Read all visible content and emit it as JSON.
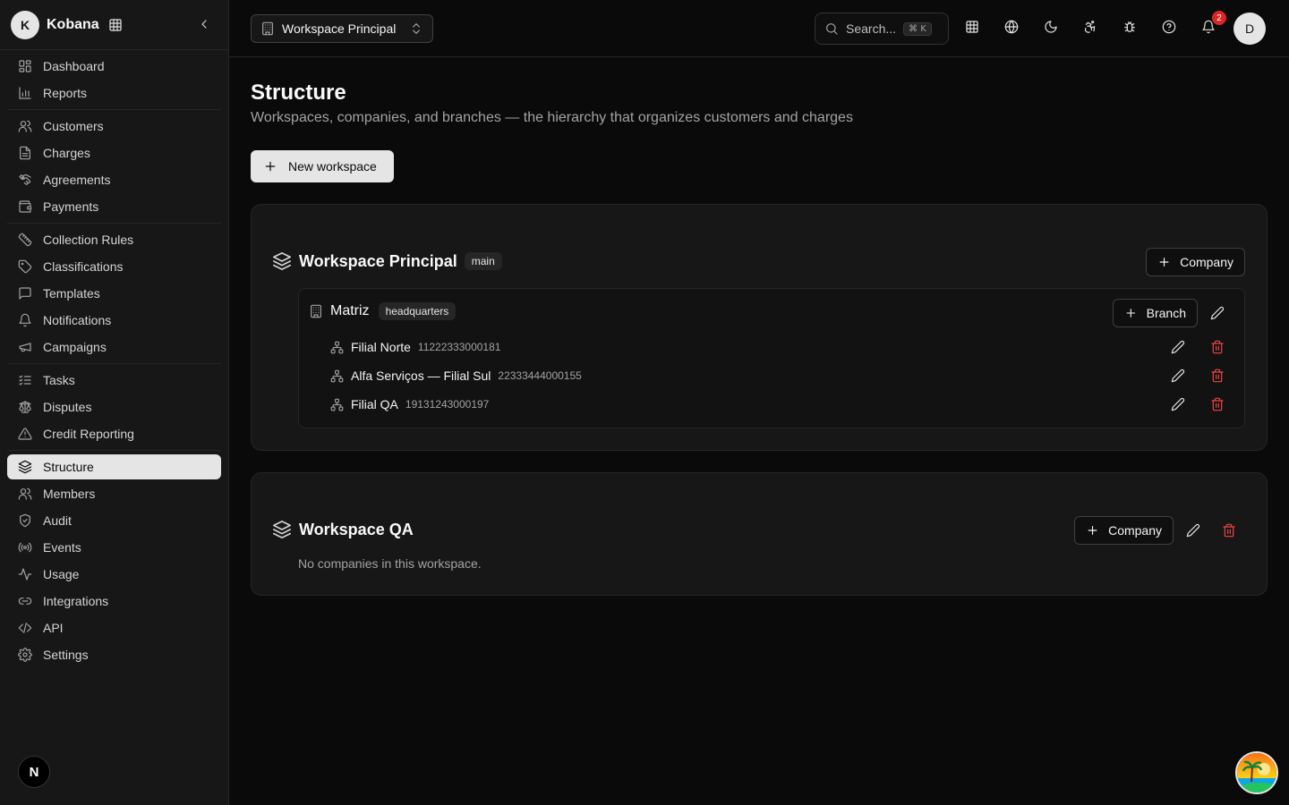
{
  "brand": {
    "initial": "K",
    "name": "Kobana"
  },
  "nav": {
    "dashboard": "Dashboard",
    "reports": "Reports",
    "customers": "Customers",
    "charges": "Charges",
    "agreements": "Agreements",
    "payments": "Payments",
    "collection_rules": "Collection Rules",
    "classifications": "Classifications",
    "templates": "Templates",
    "notifications": "Notifications",
    "campaigns": "Campaigns",
    "tasks": "Tasks",
    "disputes": "Disputes",
    "credit_reporting": "Credit Reporting",
    "structure": "Structure",
    "members": "Members",
    "audit": "Audit",
    "events": "Events",
    "usage": "Usage",
    "integrations": "Integrations",
    "api": "API",
    "settings": "Settings"
  },
  "topbar": {
    "workspace": "Workspace Principal",
    "search_placeholder": "Search...",
    "search_shortcut": "⌘ K",
    "notification_count": "2",
    "user_initial": "D"
  },
  "page": {
    "title": "Structure",
    "subtitle": "Workspaces, companies, and branches — the hierarchy that organizes customers and charges",
    "new_workspace": "New workspace"
  },
  "workspaces": [
    {
      "name": "Workspace Principal",
      "tag": "main",
      "add_company": "Company",
      "company": {
        "name": "Matriz",
        "tag": "headquarters",
        "add_branch": "Branch",
        "branches": [
          {
            "name": "Filial Norte",
            "doc": "11222333000181"
          },
          {
            "name": "Alfa Serviços — Filial Sul",
            "doc": "22333444000155"
          },
          {
            "name": "Filial QA",
            "doc": "19131243000197"
          }
        ]
      }
    },
    {
      "name": "Workspace QA",
      "add_company": "Company",
      "empty": "No companies in this workspace."
    }
  ],
  "footer": {
    "next_badge": "N"
  }
}
